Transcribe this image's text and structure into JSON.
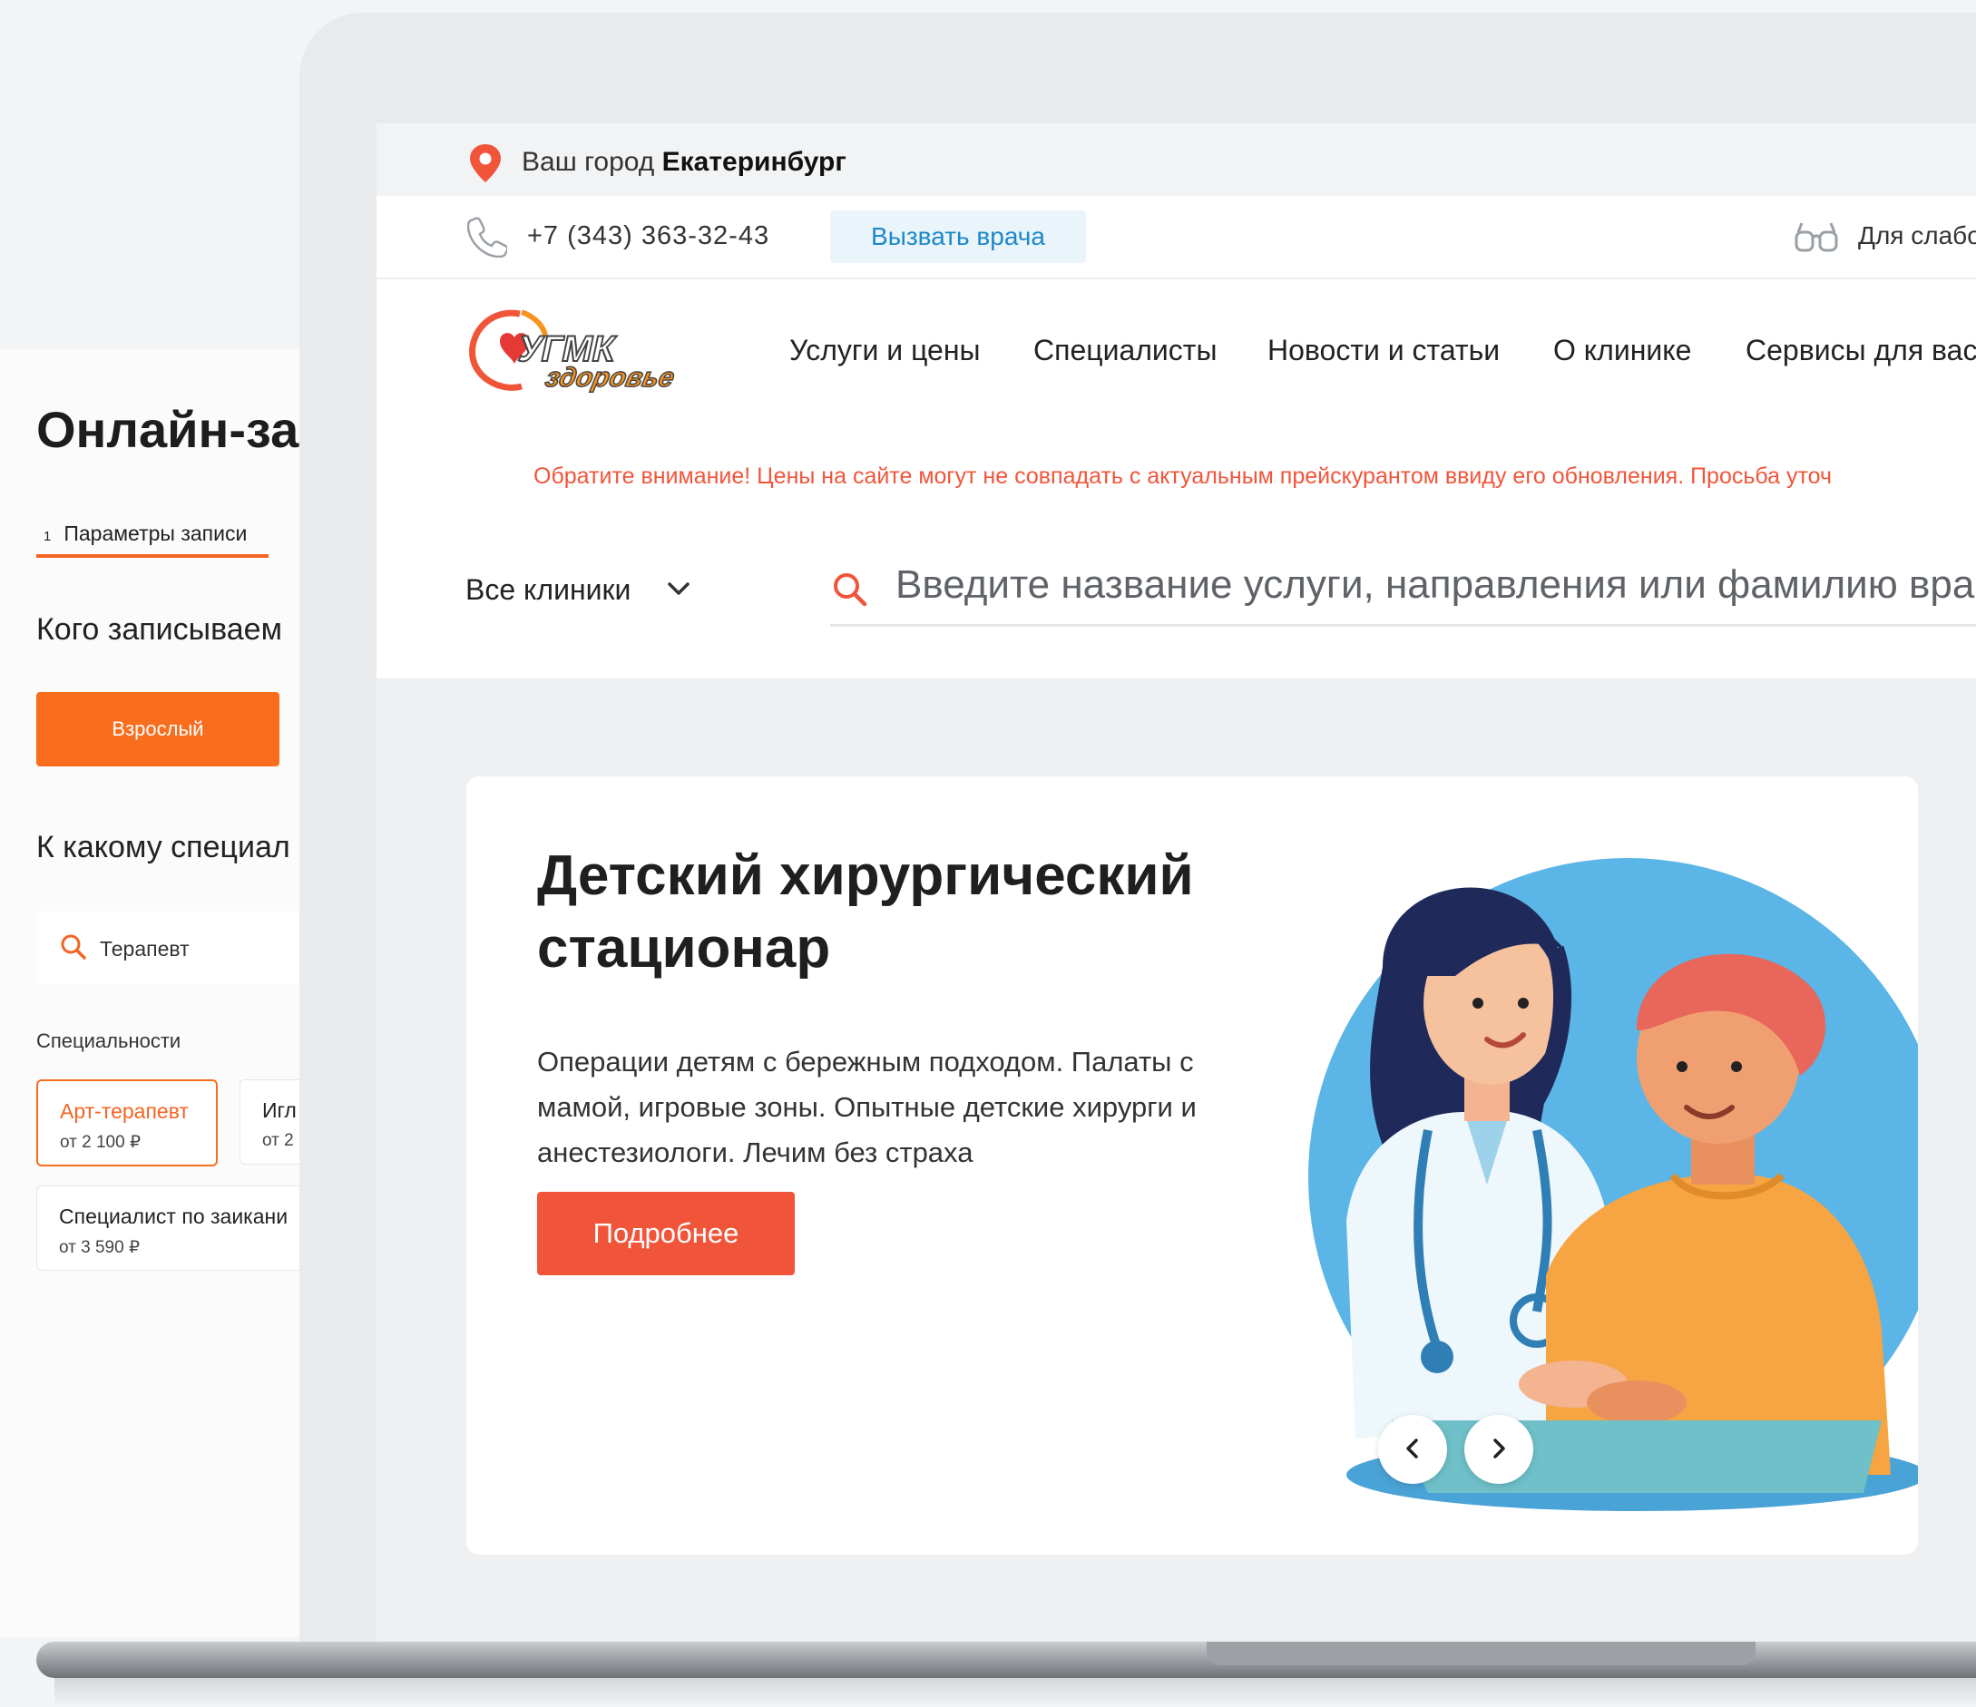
{
  "booking": {
    "title": "Онлайн-за",
    "step_number": "1",
    "step_label": "Параметры записи",
    "who_question": "Кого записываем",
    "adult_button": "Взрослый",
    "specialist_question": "К какому специал",
    "search_value": "Терапевт",
    "specialties_label": "Специальности",
    "specialties": [
      {
        "name": "Арт-терапевт",
        "price": "от 2 100 ₽"
      },
      {
        "name": "Игл",
        "price": "от 2"
      },
      {
        "name": "Специалист по заикани",
        "price": "от 3 590 ₽"
      }
    ]
  },
  "site": {
    "city_label": "Ваш город",
    "city": "Екатеринбург",
    "phone": "+7 (343) 363-32-43",
    "call_doctor": "Вызвать врача",
    "accessibility": "Для слабо",
    "logo_text_top": "УГМК",
    "logo_text_bottom": "здоровье",
    "nav": [
      "Услуги и цены",
      "Специалисты",
      "Новости и статьи",
      "О клинике",
      "Сервисы для вас"
    ],
    "notice": "Обратите внимание! Цены на сайте могут не совпадать с актуальным прейскурантом ввиду его обновления. Просьба уточ",
    "clinic_select": "Все клиники",
    "search_placeholder": "Введите название услуги, направления или фамилию врача"
  },
  "hero": {
    "title_line1": "Детский хирургический",
    "title_line2": "стационар",
    "text": "Операции детям с бережным подходом. Палаты с мамой, игровые зоны. Опытные детские хирурги и анестезиологи. Лечим без страха",
    "button": "Подробнее"
  },
  "colors": {
    "accent_orange": "#f86d1e",
    "hero_red": "#f0553a",
    "call_blue": "#1e88c8",
    "illus_blue": "#5bb5e6"
  },
  "icons": {
    "pin": "map-pin-icon",
    "phone": "phone-icon",
    "glasses": "glasses-icon",
    "search": "search-icon",
    "chevron": "chevron-down-icon",
    "prev": "chevron-left-icon",
    "next": "chevron-right-icon"
  }
}
